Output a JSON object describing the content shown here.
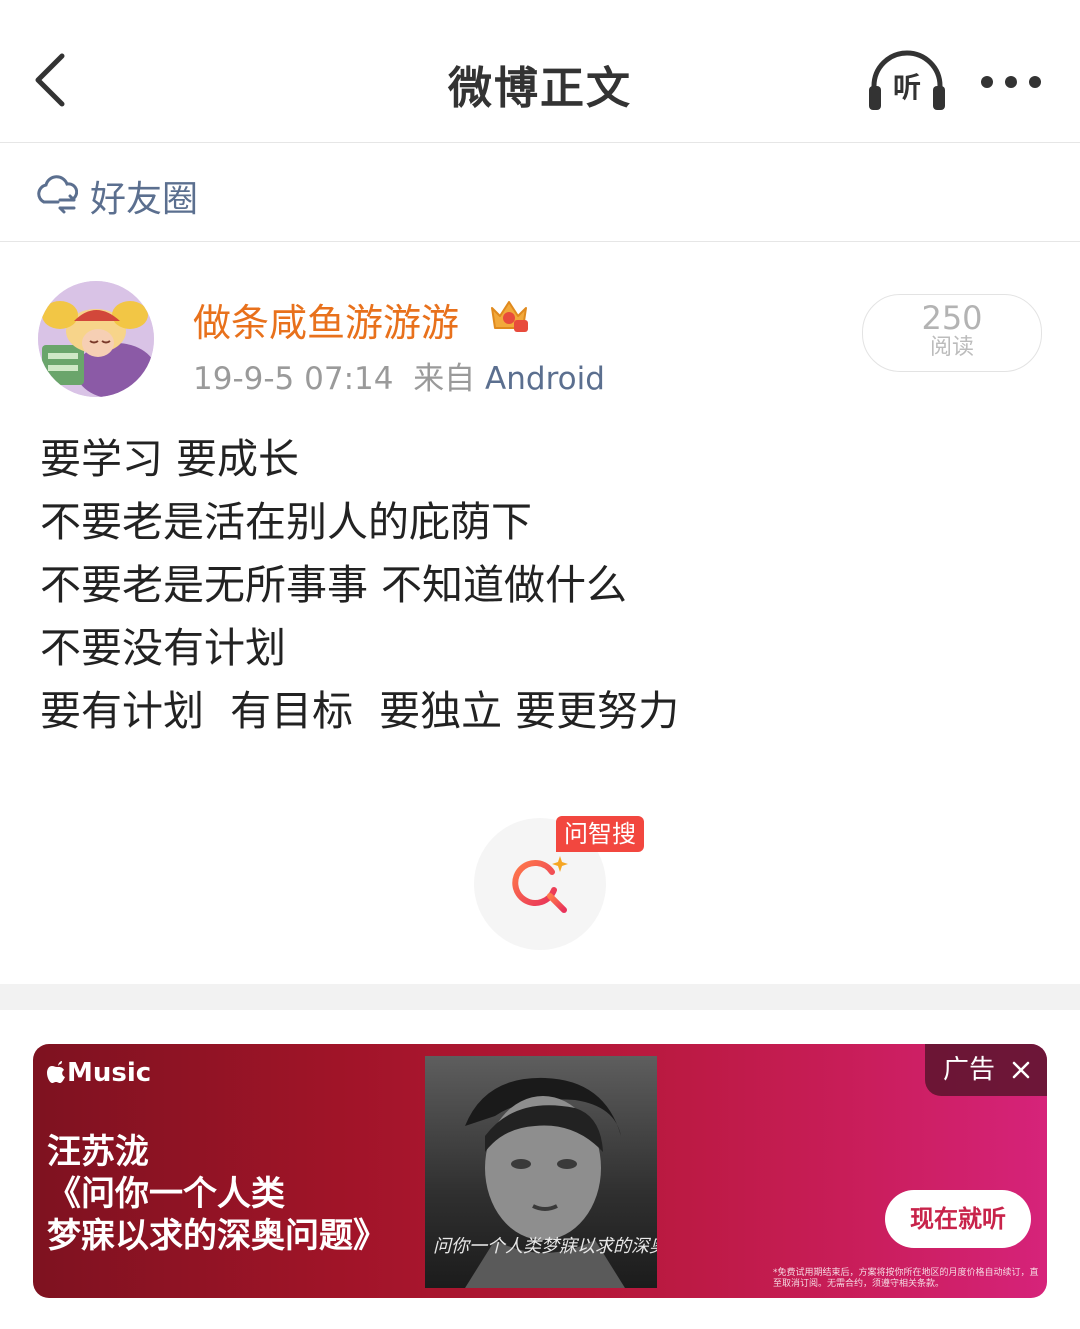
{
  "header": {
    "title": "微博正文",
    "listen_label": "听"
  },
  "circle": {
    "label": "好友圈"
  },
  "post": {
    "author": "做条咸鱼游游游",
    "timestamp": "19-9-5 07:14",
    "from_prefix": "来自",
    "source": "Android",
    "reads_count": "250",
    "reads_label": "阅读",
    "lines": [
      "要学习 要成长",
      "不要老是活在别人的庇荫下",
      "不要老是无所事事 不知道做什么",
      "不要没有计划",
      "要有计划  有目标  要独立 要更努力"
    ],
    "ask_badge": "问智搜"
  },
  "ad": {
    "brand": "Music",
    "artist": "汪苏泷",
    "album_line1": "《问你一个人类",
    "album_line2": "梦寐以求的深奥问题》",
    "cover_text": "问你一个人类梦寐以求的深奥问题",
    "label": "广告",
    "cta": "现在就听",
    "fine_print": "*免费试用期结束后，方案将按你所在地区的月度价格自动续订，直至取消订阅。无需合约，须遵守相关条款。"
  },
  "colors": {
    "username": "#e8711c",
    "link": "#5b6f8f",
    "badge": "#f2473f"
  }
}
